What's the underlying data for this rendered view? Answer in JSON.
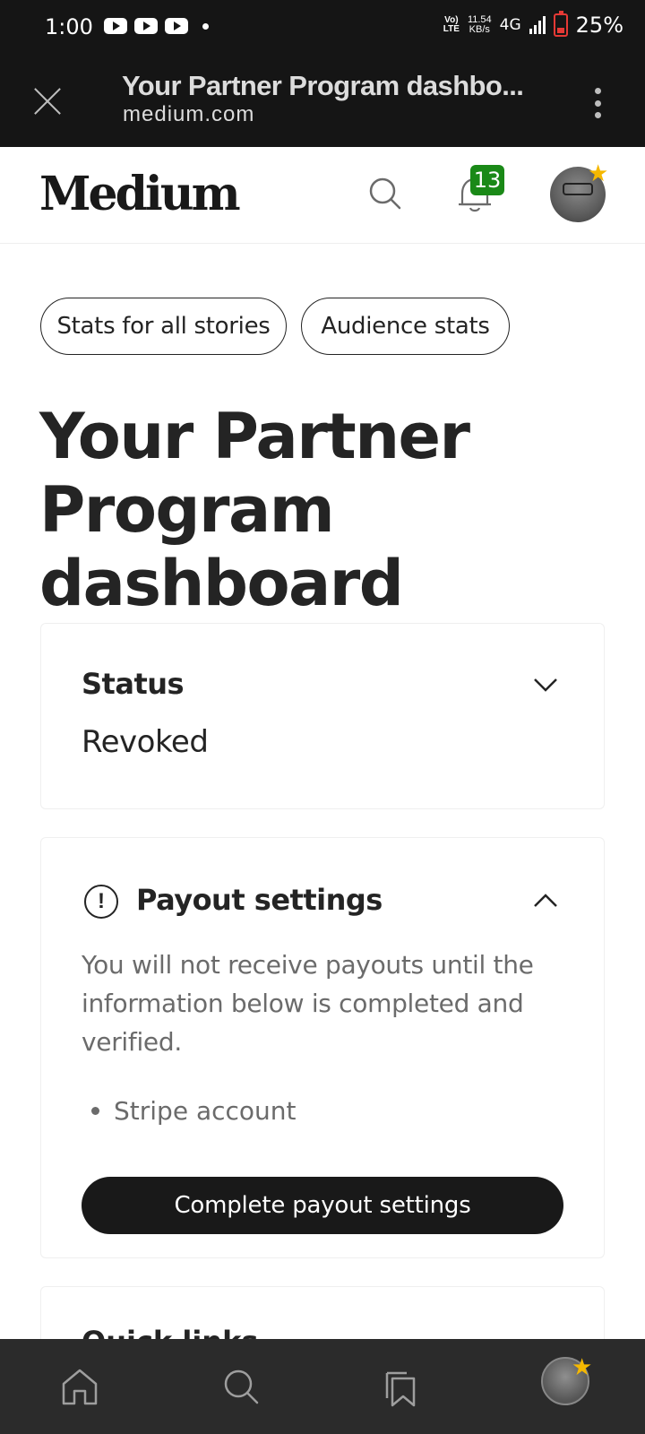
{
  "status_bar": {
    "time": "1:00",
    "volte": [
      "Vo)",
      "LTE"
    ],
    "speed": [
      "11.54",
      "KB/s"
    ],
    "network": "4G",
    "battery": "25%"
  },
  "browser": {
    "title": "Your Partner Program dashbo...",
    "url": "medium.com"
  },
  "header": {
    "logo": "Medium",
    "notification_count": "13"
  },
  "tabs": [
    {
      "label": "Stats for all stories"
    },
    {
      "label": "Audience stats"
    }
  ],
  "page": {
    "title": "Your Partner Program dashboard"
  },
  "status_card": {
    "heading": "Status",
    "value": "Revoked"
  },
  "payout_card": {
    "heading": "Payout settings",
    "description": "You will not receive payouts until the information below is completed and verified.",
    "items": [
      "Stripe account"
    ],
    "button_label": "Complete payout settings"
  },
  "quick_links_card": {
    "heading": "Quick links"
  },
  "colors": {
    "accent": "#1a8917",
    "star": "#f5b800",
    "text_primary": "#242424",
    "text_secondary": "#6b6b6b"
  }
}
